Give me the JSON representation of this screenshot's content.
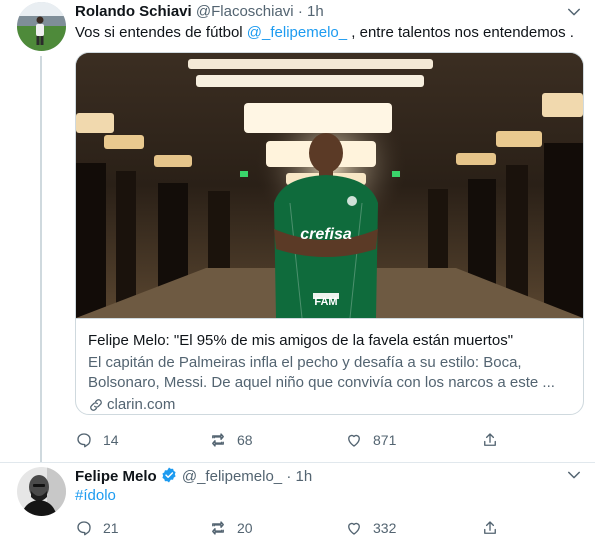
{
  "tweets": [
    {
      "author_name": "Rolando Schiavi",
      "handle": "@Flacoschiavi",
      "dot": "·",
      "time": "1h",
      "text_before": "Vos si entendes de fútbol ",
      "mention": "@_felipemelo_",
      "text_after": " , entre talentos nos entendemos .",
      "card": {
        "title": "Felipe Melo: \"El 95% de mis amigos de la favela están muertos\"",
        "description": "El capitán de Palmeiras infla el pecho y desafía a su estilo: Boca, Bolsonaro, Messi. De aquel niño que convivía con los narcos a este ...",
        "domain": "clarin.com",
        "image_jersey_text": "crefisa",
        "image_sponsor_text": "FAM"
      },
      "actions": {
        "replies": "14",
        "retweets": "68",
        "likes": "871"
      }
    },
    {
      "author_name": "Felipe Melo",
      "handle": "@_felipemelo_",
      "dot": "·",
      "time": "1h",
      "hashtag": "#ídolo",
      "verified": true,
      "actions": {
        "replies": "21",
        "retweets": "20",
        "likes": "332"
      }
    }
  ],
  "colors": {
    "accent": "#1d9bf0",
    "muted": "#536471",
    "text": "#0f1419",
    "border": "#cfd9de"
  },
  "icons": [
    "reply-icon",
    "retweet-icon",
    "like-icon",
    "share-icon",
    "caret-down-icon",
    "verified-badge-icon",
    "link-icon"
  ]
}
